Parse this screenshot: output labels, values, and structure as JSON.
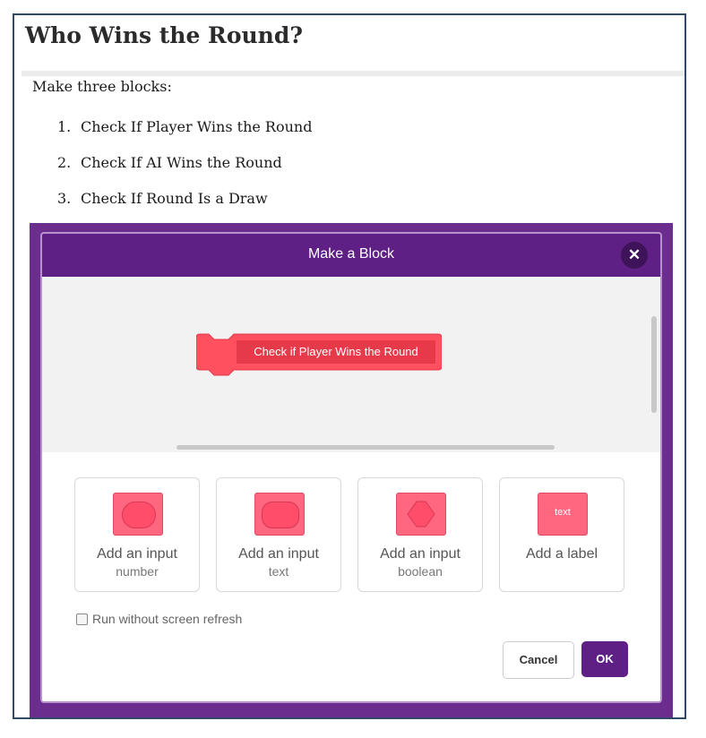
{
  "doc": {
    "title": "Who Wins the Round?",
    "intro": "Make three blocks:",
    "steps": [
      {
        "num": "1.",
        "text": "Check If Player Wins the Round"
      },
      {
        "num": "2.",
        "text": "Check If AI Wins the Round"
      },
      {
        "num": "3.",
        "text": "Check If Round Is a Draw"
      }
    ]
  },
  "dialog": {
    "title": "Make a Block",
    "close_icon": "close-icon",
    "block_label": "Check if Player Wins the Round",
    "options": [
      {
        "title": "Add an input",
        "sub": "number",
        "icon": "number-input-icon"
      },
      {
        "title": "Add an input",
        "sub": "text",
        "icon": "text-input-icon"
      },
      {
        "title": "Add an input",
        "sub": "boolean",
        "icon": "boolean-input-icon"
      },
      {
        "title": "Add a label",
        "sub": "",
        "icon": "label-icon",
        "icon_text": "text"
      }
    ],
    "refresh_label": "Run without screen refresh",
    "cancel_label": "Cancel",
    "ok_label": "OK"
  },
  "colors": {
    "accent_purple": "#5f2085",
    "block_red": "#ff4d6a",
    "border_navy": "#2f4a66"
  }
}
